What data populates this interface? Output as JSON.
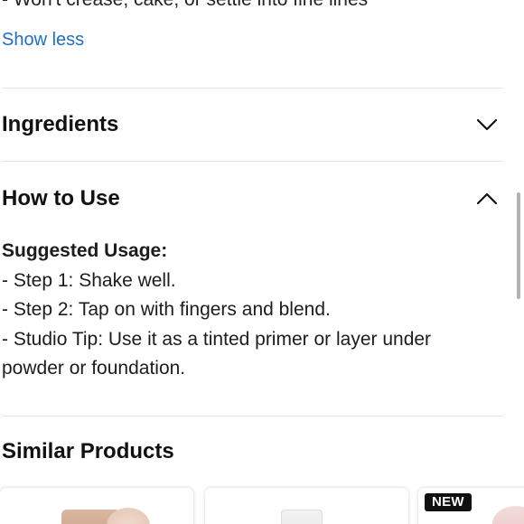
{
  "description": {
    "cut_line": "- Won't crease, cake, or settle into fine lines",
    "show_less_label": "Show less"
  },
  "sections": [
    {
      "title": "Ingredients",
      "icon": "chevron-down-icon",
      "expanded": false
    },
    {
      "title": "How to Use",
      "icon": "chevron-up-icon",
      "expanded": true
    }
  ],
  "how_to_use": {
    "heading": "Suggested Usage:",
    "lines": [
      "- Step 1: Shake well.",
      "- Step 2: Tap on with fingers and blend.",
      "- Studio Tip: Use it as a tinted primer or layer under",
      "powder or foundation."
    ]
  },
  "similar_products": {
    "title": "Similar Products",
    "cards": [
      {
        "badge": ""
      },
      {
        "badge": ""
      },
      {
        "badge": "NEW"
      }
    ]
  },
  "colors": {
    "link": "#1f6fbf",
    "text": "#111111",
    "divider": "#e3e3e3",
    "badge_bg": "#111111"
  }
}
